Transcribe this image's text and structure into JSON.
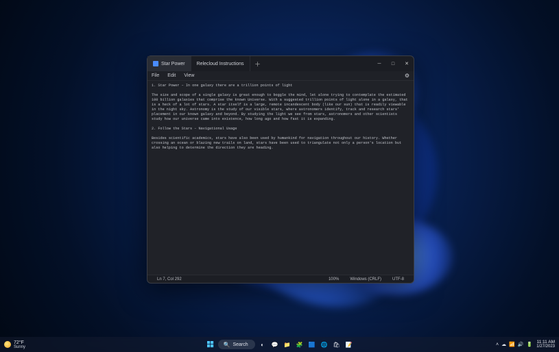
{
  "window": {
    "tabs": [
      {
        "label": "Star Power",
        "active": true
      },
      {
        "label": "Relecloud Instructions",
        "active": false
      }
    ],
    "menu": {
      "file": "File",
      "edit": "Edit",
      "view": "View"
    },
    "content": "1. Star Power – In one galaxy there are a trillion points of light\n\nThe size and scope of a single galaxy is great enough to boggle the mind, let alone trying to contemplate the estimated 100 billion galaxies that comprise the known Universe. With a suggested trillion points of light alone in a galaxy, that is a heck of a lot of stars. A star itself is a large, remote incandescent body (like our sun) that is readily viewable in the night sky. Astronomy is the study of our visible stars, where astronomers identify, track and research stars' placement in our known galaxy and beyond. By studying the light we see from stars, astronomers and other scientists study how our universe came into existence, how long ago and how fast it is expanding.\n\n2. Follow the Stars – Navigational Usage\n\nBesides scientific academics, stars have also been used by humankind for navigation throughout our history. Whether crossing an ocean or blazing new trails on land, stars have been used to triangulate not only a person's location but also helping to determine the direction they are heading.",
    "status": {
      "position": "Ln 7, Col 292",
      "zoom": "100%",
      "line_endings": "Windows (CRLF)",
      "encoding": "UTF-8"
    }
  },
  "taskbar": {
    "weather": {
      "temp": "72°F",
      "condition": "Sunny"
    },
    "search_placeholder": "Search",
    "clock": {
      "time": "11:11 AM",
      "date": "1/27/2023"
    }
  }
}
